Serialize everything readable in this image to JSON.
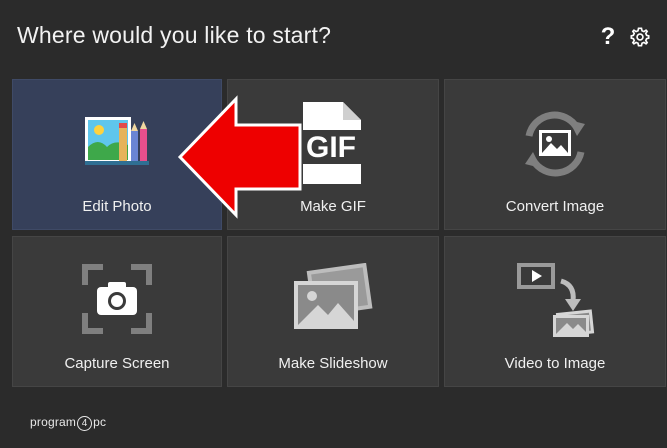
{
  "header": {
    "title": "Where would you like to start?",
    "help_label": "?"
  },
  "tiles": [
    {
      "label": "Edit Photo",
      "icon": "paint-palette-icon",
      "selected": true
    },
    {
      "label": "Make GIF",
      "icon": "gif-file-icon",
      "selected": false
    },
    {
      "label": "Convert Image",
      "icon": "convert-image-icon",
      "selected": false
    },
    {
      "label": "Capture Screen",
      "icon": "camera-capture-icon",
      "selected": false
    },
    {
      "label": "Make Slideshow",
      "icon": "slideshow-photos-icon",
      "selected": false
    },
    {
      "label": "Video to Image",
      "icon": "video-to-image-icon",
      "selected": false
    }
  ],
  "footer": {
    "logo_prefix": "program",
    "logo_digit": "4",
    "logo_suffix": "pc"
  },
  "colors": {
    "background": "#2b2b2b",
    "tile": "#3a3a3a",
    "tile_selected": "#36405a",
    "arrow": "#ee0000"
  }
}
